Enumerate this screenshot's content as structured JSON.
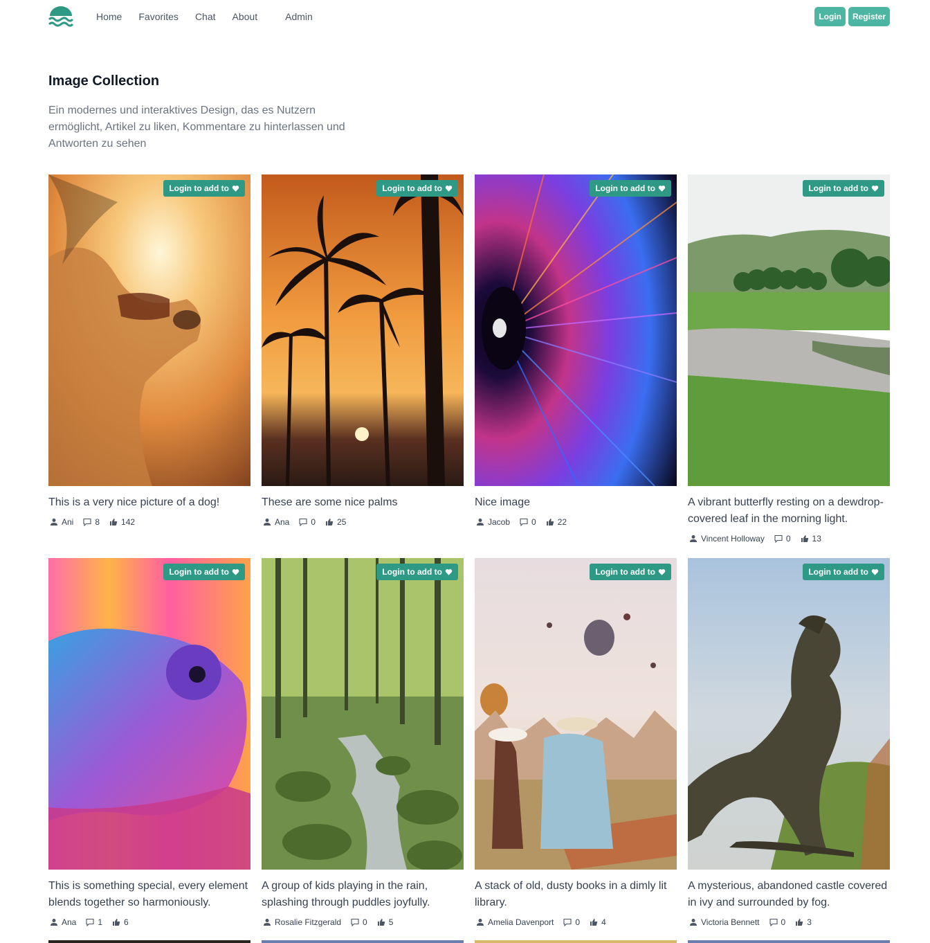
{
  "nav": {
    "items": [
      "Home",
      "Favorites",
      "Chat",
      "About",
      "Admin"
    ],
    "login_label": "Login",
    "register_label": "Register"
  },
  "page": {
    "title": "Image Collection",
    "description": "Ein modernes und interaktives Design, das es Nutzern ermöglicht, Artikel zu liken, Kommentare zu hinterlassen und Antworten zu sehen"
  },
  "fav_label": "Login to add to",
  "colors": {
    "accent": "#4db6a2",
    "badge": "#2e9a86"
  },
  "icons": [
    "user-icon",
    "comment-icon",
    "thumbs-up-icon",
    "heart-icon"
  ],
  "cards": [
    {
      "caption": "This is a very nice picture of a dog!",
      "author": "Ani",
      "comments": "8",
      "likes": "142"
    },
    {
      "caption": "These are some nice palms",
      "author": "Ana",
      "comments": "0",
      "likes": "25"
    },
    {
      "caption": "Nice image",
      "author": "Jacob",
      "comments": "0",
      "likes": "22"
    },
    {
      "caption": "A vibrant butterfly resting on a dewdrop-covered leaf in the morning light.",
      "author": "Vincent Holloway",
      "comments": "0",
      "likes": "13"
    },
    {
      "caption": "This is something special, every element blends together so harmoniously.",
      "author": "Ana",
      "comments": "1",
      "likes": "6"
    },
    {
      "caption": "A group of kids playing in the rain, splashing through puddles joyfully.",
      "author": "Rosalie Fitzgerald",
      "comments": "0",
      "likes": "5"
    },
    {
      "caption": "A stack of old, dusty books in a dimly lit library.",
      "author": "Amelia Davenport",
      "comments": "0",
      "likes": "4"
    },
    {
      "caption": "A mysterious, abandoned castle covered in ivy and surrounded by fog.",
      "author": "Victoria Bennett",
      "comments": "0",
      "likes": "3"
    }
  ]
}
